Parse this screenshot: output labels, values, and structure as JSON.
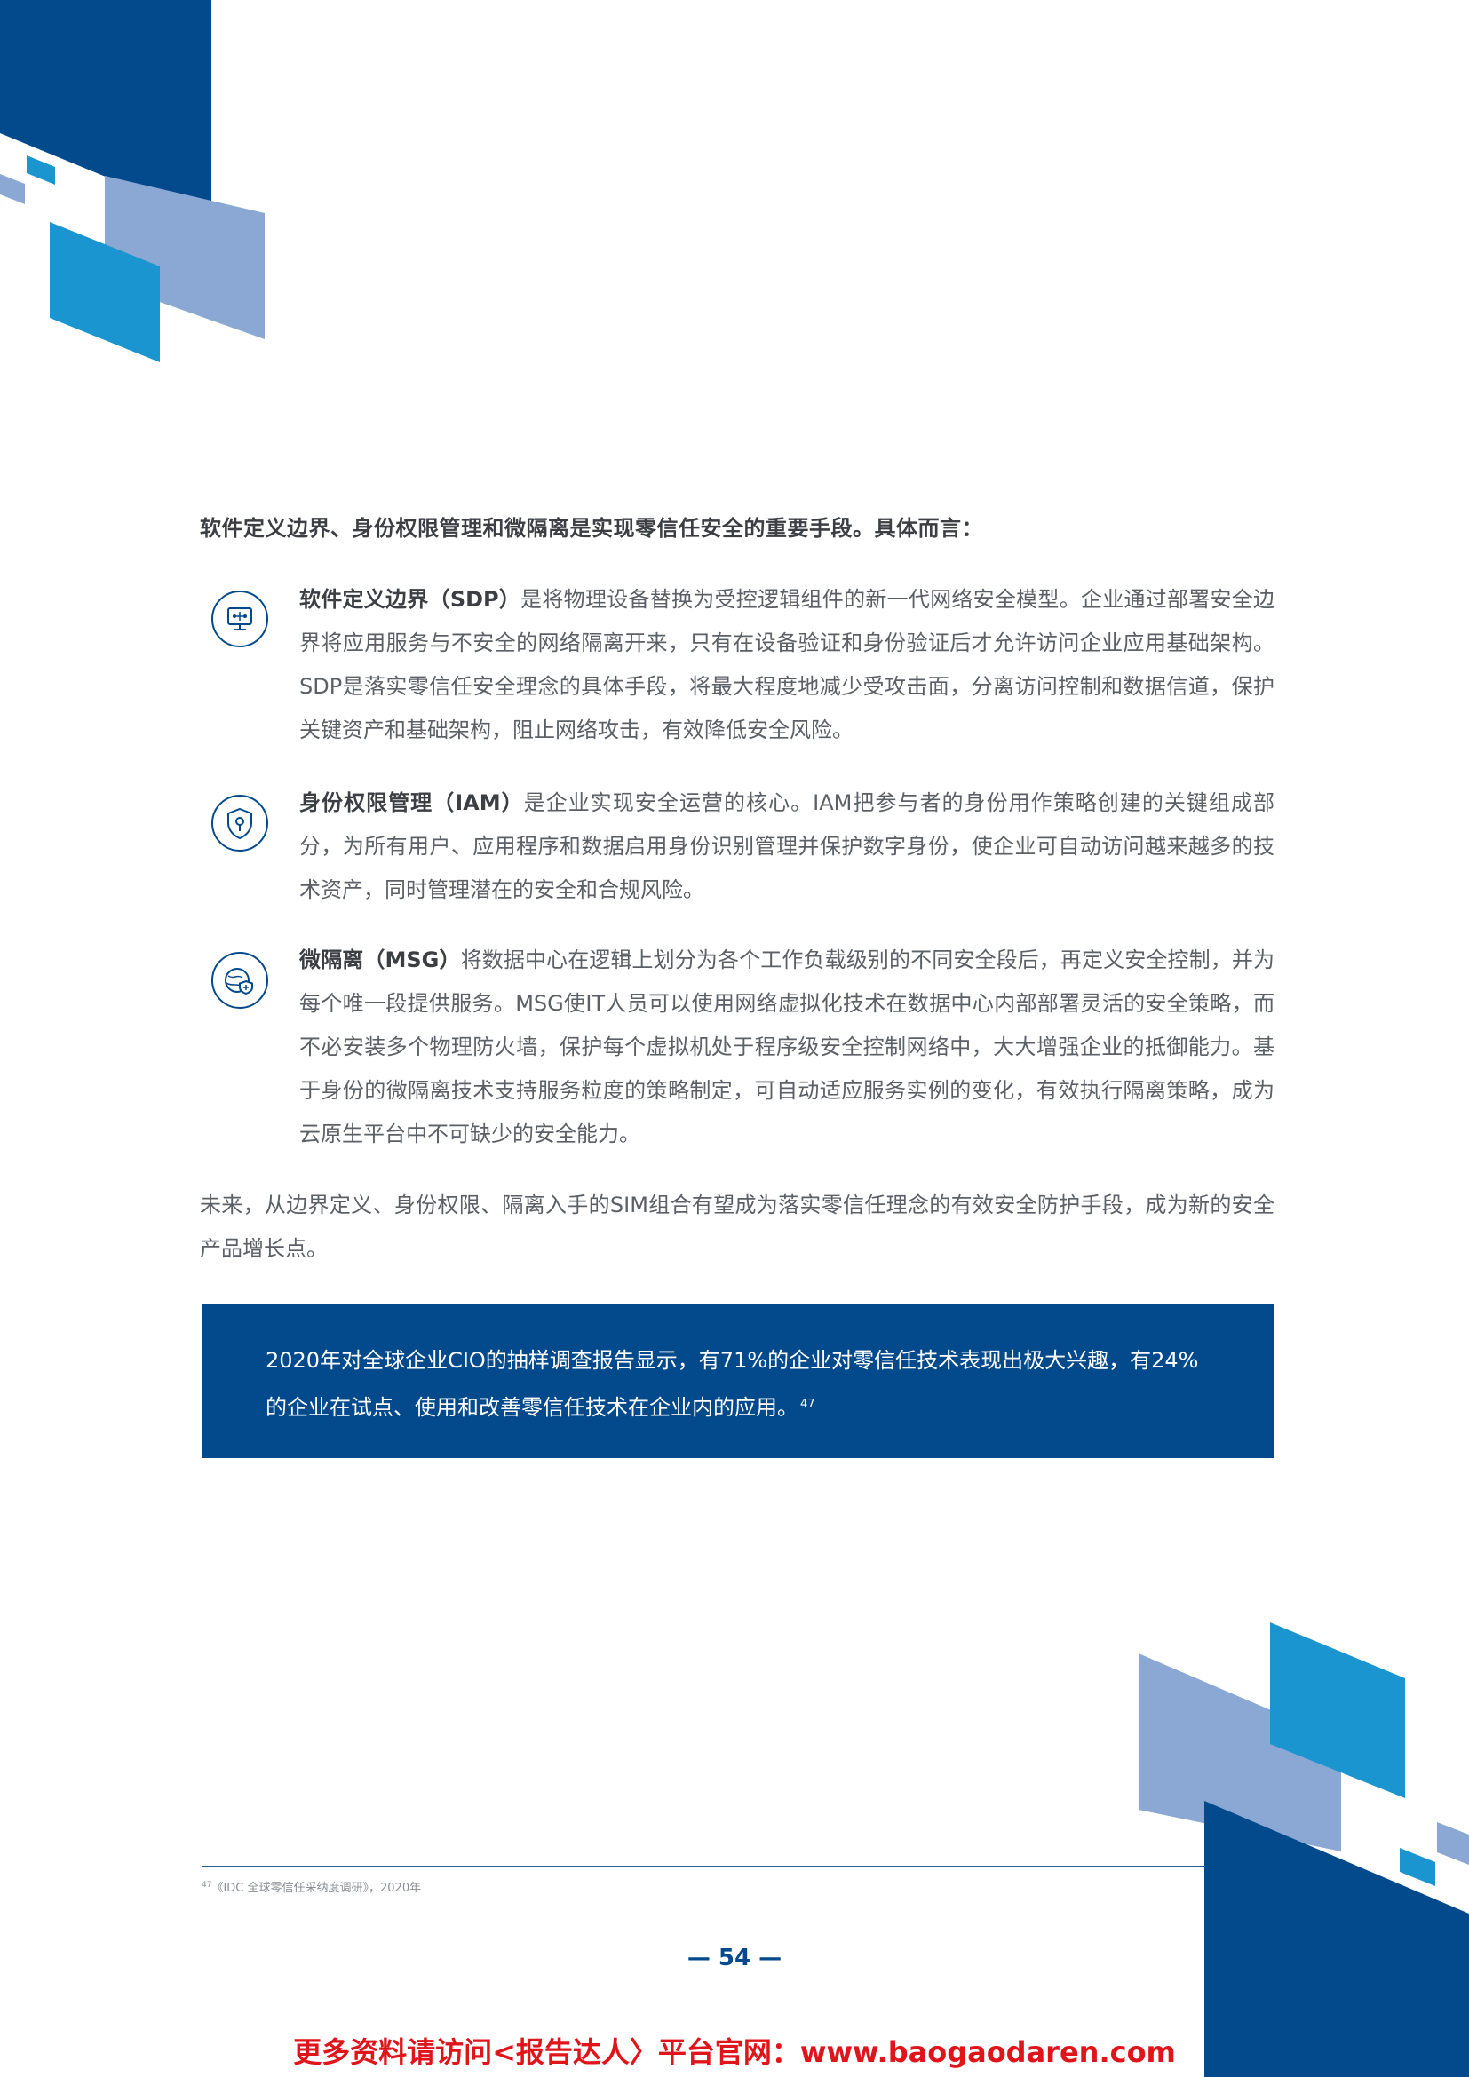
{
  "intro": "软件定义边界、身份权限管理和微隔离是实现零信任安全的重要手段。具体而言：",
  "items": [
    {
      "term": "软件定义边界（SDP）",
      "body": "是将物理设备替换为受控逻辑组件的新一代网络安全模型。企业通过部署安全边界将应用服务与不安全的网络隔离开来，只有在设备验证和身份验证后才允许访问企业应用基础架构。SDP是落实零信任安全理念的具体手段，将最大程度地减少受攻击面，分离访问控制和数据信道，保护关键资产和基础架构，阻止网络攻击，有效降低安全风险。",
      "icon": "monitor-network-icon"
    },
    {
      "term": "身份权限管理（IAM）",
      "body": "是企业实现安全运营的核心。IAM把参与者的身份用作策略创建的关键组成部分，为所有用户、应用程序和数据启用身份识别管理并保护数字身份，使企业可自动访问越来越多的技术资产，同时管理潜在的安全和合规风险。",
      "icon": "shield-key-icon"
    },
    {
      "term": "微隔离（MSG）",
      "body": "将数据中心在逻辑上划分为各个工作负载级别的不同安全段后，再定义安全控制，并为每个唯一段提供服务。MSG使IT人员可以使用网络虚拟化技术在数据中心内部部署灵活的安全策略，而不必安装多个物理防火墙，保护每个虚拟机处于程序级安全控制网络中，大大增强企业的抵御能力。基于身份的微隔离技术支持服务粒度的策略制定，可自动适应服务实例的变化，有效执行隔离策略，成为云原生平台中不可缺少的安全能力。",
      "icon": "globe-shield-icon"
    }
  ],
  "future": "未来，从边界定义、身份权限、隔离入手的SIM组合有望成为落实零信任理念的有效安全防护手段，成为新的安全产品增长点。",
  "callout": {
    "text": "2020年对全球企业CIO的抽样调查报告显示，有71%的企业对零信任技术表现出极大兴趣，有24%的企业在试点、使用和改善零信任技术在企业内的应用。",
    "ref": "47"
  },
  "footnote": {
    "ref": "47",
    "text": "《IDC 全球零信任采纳度调研》，2020年"
  },
  "page_number": "— 54 —",
  "watermark": "更多资料请访问<报告达人〉平台官网：www.baogaodaren.com",
  "colors": {
    "navy": "#034a8c",
    "blue": "#1a95d0",
    "light_blue": "#8aa8d3",
    "red": "#e0141b"
  }
}
